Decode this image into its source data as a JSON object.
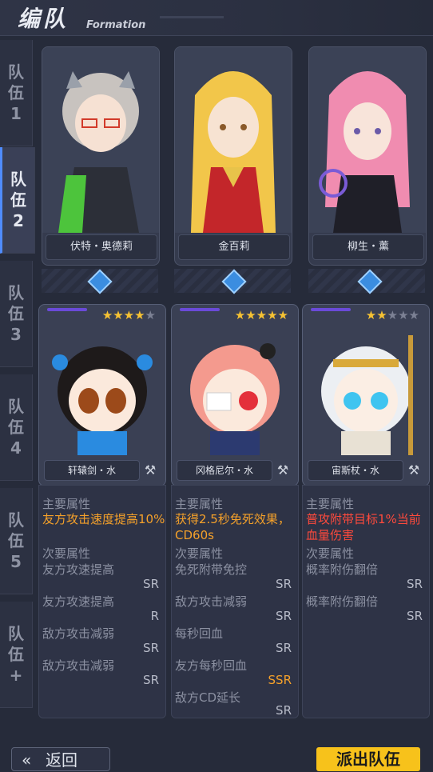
{
  "header": {
    "title": "编队",
    "subtitle": "Formation"
  },
  "sidebar": {
    "tabs": [
      {
        "label": "队伍1",
        "active": false
      },
      {
        "label": "队伍2",
        "active": true
      },
      {
        "label": "队伍3",
        "active": false
      },
      {
        "label": "队伍4",
        "active": false
      },
      {
        "label": "队伍5",
        "active": false
      },
      {
        "label": "队伍+",
        "active": false
      }
    ]
  },
  "characters": [
    {
      "name": "伏特・奥德莉",
      "hair_color": "#c8c3bf"
    },
    {
      "name": "金百莉",
      "hair_color": "#f2c64a"
    },
    {
      "name": "柳生・薰",
      "hair_color": "#f08cb0"
    }
  ],
  "pets": [
    {
      "name": "轩辕剑・水",
      "stars": 4,
      "max_stars": 5,
      "main_label": "主要属性",
      "main_attr": "友方攻击速度提高10%",
      "sub_label": "次要属性",
      "sub_attrs": [
        {
          "text": "友方攻速提高",
          "rank": "SR"
        },
        {
          "text": "友方攻速提高",
          "rank": "R"
        },
        {
          "text": "敌方攻击减弱",
          "rank": "SR"
        },
        {
          "text": "敌方攻击减弱",
          "rank": "SR"
        }
      ]
    },
    {
      "name": "冈格尼尔・水",
      "stars": 5,
      "max_stars": 5,
      "main_label": "主要属性",
      "main_attr": "获得2.5秒免死效果，CD60s",
      "sub_label": "次要属性",
      "sub_attrs": [
        {
          "text": "免死附带免控",
          "rank": "SR"
        },
        {
          "text": "敌方攻击减弱",
          "rank": "SR"
        },
        {
          "text": "每秒回血",
          "rank": "SR"
        },
        {
          "text": "友方每秒回血",
          "rank": "SSR"
        },
        {
          "text": "敌方CD延长",
          "rank": "SR"
        }
      ]
    },
    {
      "name": "宙斯杖・水",
      "stars": 2,
      "max_stars": 5,
      "main_label": "主要属性",
      "main_attr": "普攻附带目标1%当前血量伤害",
      "sub_label": "次要属性",
      "sub_attrs": [
        {
          "text": "概率附伤翻倍",
          "rank": "SR"
        },
        {
          "text": "概率附伤翻倍",
          "rank": "SR"
        }
      ]
    }
  ],
  "footer": {
    "back_label": "返回",
    "deploy_label": "派出队伍"
  }
}
